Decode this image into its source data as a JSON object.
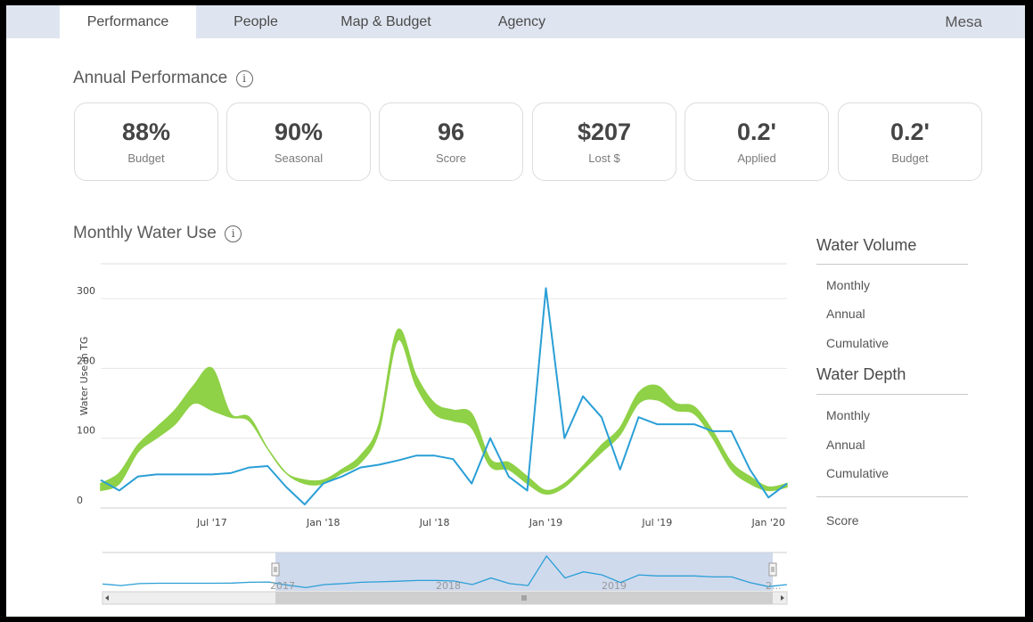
{
  "tabs": {
    "items": [
      {
        "label": "Performance",
        "active": true
      },
      {
        "label": "People",
        "active": false
      },
      {
        "label": "Map & Budget",
        "active": false
      },
      {
        "label": "Agency",
        "active": false
      }
    ],
    "owner": "Mesa"
  },
  "annual": {
    "title": "Annual Performance",
    "info_glyph": "i",
    "kpis": [
      {
        "value": "88%",
        "label": "Budget"
      },
      {
        "value": "90%",
        "label": "Seasonal"
      },
      {
        "value": "96",
        "label": "Score"
      },
      {
        "value": "$207",
        "label": "Lost $"
      },
      {
        "value": "0.2'",
        "label": "Applied"
      },
      {
        "value": "0.2'",
        "label": "Budget"
      }
    ]
  },
  "monthly": {
    "title": "Monthly Water Use",
    "info_glyph": "i"
  },
  "sidebar": {
    "volume_heading": "Water Volume",
    "volume_items": [
      "Monthly",
      "Annual",
      "Cumulative"
    ],
    "depth_heading": "Water Depth",
    "depth_items": [
      "Monthly",
      "Annual",
      "Cumulative"
    ],
    "score_label": "Score"
  },
  "colors": {
    "band": "#8fd147",
    "line": "#2a9fd6",
    "navigator_fill": "#c8d4ea",
    "tabbar": "#dfe5f0"
  },
  "chart_data": {
    "type": "line",
    "title": "",
    "xlabel": "",
    "ylabel": "Water Use in TG",
    "ylim": [
      0,
      350
    ],
    "y_ticks": [
      0,
      100,
      200,
      300
    ],
    "x_ticks": [
      "Jul '17",
      "Jan '18",
      "Jul '18",
      "Jan '19",
      "Jul '19",
      "Jan '20"
    ],
    "x_tick_months": [
      6,
      12,
      18,
      24,
      30,
      36
    ],
    "grid": true,
    "series": [
      {
        "kind": "band",
        "x": [
          0,
          1,
          2,
          3,
          4,
          5,
          6,
          7,
          8,
          9,
          10,
          11,
          12,
          13,
          14,
          15,
          16,
          17,
          18,
          19,
          20,
          21,
          22,
          23,
          24,
          25,
          26,
          27,
          28,
          29,
          30,
          31,
          32,
          33,
          34,
          35,
          36,
          37
        ],
        "low": [
          25,
          35,
          80,
          100,
          120,
          150,
          140,
          130,
          125,
          85,
          50,
          35,
          35,
          50,
          65,
          110,
          240,
          175,
          135,
          125,
          115,
          60,
          55,
          35,
          20,
          30,
          55,
          80,
          105,
          150,
          155,
          140,
          135,
          100,
          55,
          35,
          25,
          30
        ],
        "high": [
          35,
          50,
          90,
          115,
          140,
          175,
          200,
          135,
          130,
          85,
          50,
          40,
          40,
          55,
          75,
          120,
          255,
          190,
          150,
          140,
          135,
          70,
          65,
          45,
          25,
          35,
          60,
          90,
          115,
          165,
          175,
          150,
          145,
          110,
          65,
          45,
          30,
          35
        ]
      },
      {
        "kind": "line",
        "x": [
          0,
          1,
          2,
          3,
          4,
          5,
          6,
          7,
          8,
          9,
          10,
          11,
          12,
          13,
          14,
          15,
          16,
          17,
          18,
          19,
          20,
          21,
          22,
          23,
          24,
          25,
          26,
          27,
          28,
          29,
          30,
          31,
          32,
          33,
          34,
          35,
          36,
          37
        ],
        "values": [
          40,
          25,
          45,
          48,
          48,
          48,
          48,
          50,
          58,
          60,
          30,
          5,
          35,
          45,
          58,
          62,
          68,
          75,
          75,
          70,
          35,
          100,
          45,
          25,
          315,
          100,
          160,
          130,
          55,
          130,
          120,
          120,
          120,
          110,
          110,
          55,
          15,
          35
        ]
      }
    ],
    "navigator": {
      "labels": [
        "2017",
        "2018",
        "2019",
        "2..."
      ]
    }
  }
}
